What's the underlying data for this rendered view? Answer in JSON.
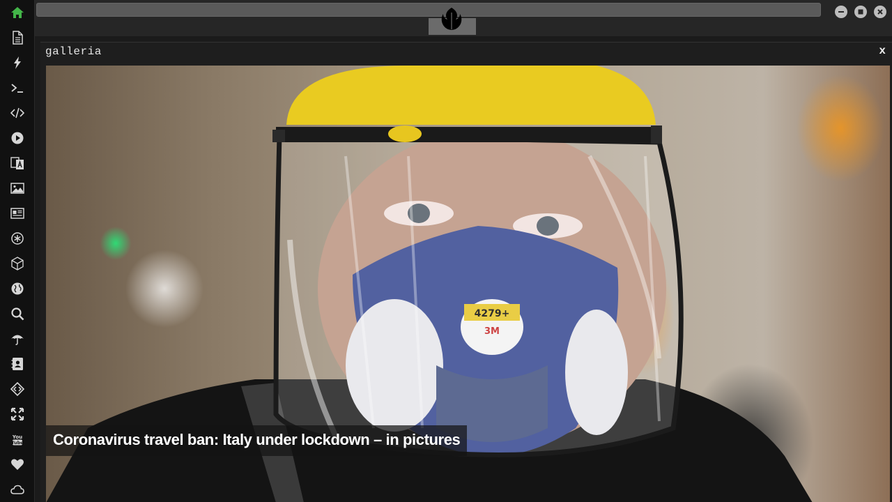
{
  "sidebar": {
    "items": [
      {
        "icon": "home-icon"
      },
      {
        "icon": "document-icon"
      },
      {
        "icon": "lightning-icon"
      },
      {
        "icon": "terminal-icon"
      },
      {
        "icon": "code-icon"
      },
      {
        "icon": "play-icon"
      },
      {
        "icon": "translate-icon"
      },
      {
        "icon": "image-icon"
      },
      {
        "icon": "news-icon"
      },
      {
        "icon": "asterisk-icon"
      },
      {
        "icon": "cube-icon"
      },
      {
        "icon": "globe-icon"
      },
      {
        "icon": "search-icon"
      },
      {
        "icon": "umbrella-icon"
      },
      {
        "icon": "contact-book-icon"
      },
      {
        "icon": "diamond-code-icon"
      },
      {
        "icon": "expand-icon"
      },
      {
        "icon": "youtube-icon"
      },
      {
        "icon": "heart-icon"
      },
      {
        "icon": "cloud-icon"
      }
    ],
    "active_color": "#43b549"
  },
  "topbar": {
    "logo_icon": "rebel-alliance-icon"
  },
  "window": {
    "title": "galleria",
    "close_label": "x"
  },
  "gallery": {
    "caption": "Coronavirus travel ban: Italy under lockdown – in pictures"
  }
}
